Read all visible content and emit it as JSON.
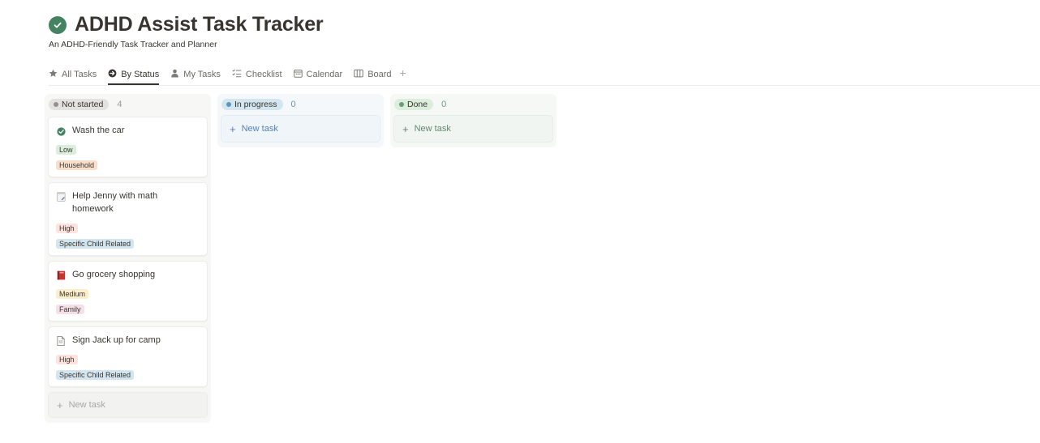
{
  "page": {
    "title": "ADHD Assist Task Tracker",
    "subtitle": "An ADHD-Friendly Task Tracker and Planner",
    "title_icon": "check-circle-icon"
  },
  "tabs": [
    {
      "label": "All Tasks",
      "icon": "star-icon",
      "active": false
    },
    {
      "label": "By Status",
      "icon": "status-arrow-icon",
      "active": true
    },
    {
      "label": "My Tasks",
      "icon": "person-icon",
      "active": false
    },
    {
      "label": "Checklist",
      "icon": "checklist-icon",
      "active": false
    },
    {
      "label": "Calendar",
      "icon": "calendar-icon",
      "active": false
    },
    {
      "label": "Board",
      "icon": "board-icon",
      "active": false
    }
  ],
  "tab_add": "+",
  "columns": [
    {
      "status": "Not started",
      "count": "4",
      "pill_bg": "#e3e2e0",
      "dot": "#91918e",
      "count_color": "#9b9a97",
      "cards": [
        {
          "title": "Wash the car",
          "icon": "check-circle-icon",
          "priority": "Low",
          "priority_bg": "#dbeddb",
          "category": "Household",
          "category_bg": "#fadec9"
        },
        {
          "title": "Help Jenny with math homework",
          "icon": "notepad-icon",
          "priority": "High",
          "priority_bg": "#ffe2dd",
          "category": "Specific Child Related",
          "category_bg": "#d3e5ef"
        },
        {
          "title": "Go grocery shopping",
          "icon": "red-book-icon",
          "priority": "Medium",
          "priority_bg": "#fbeeca",
          "category": "Family",
          "category_bg": "#f5e0e9"
        },
        {
          "title": "Sign Jack up for camp",
          "icon": "document-icon",
          "priority": "High",
          "priority_bg": "#ffe2dd",
          "category": "Specific Child Related",
          "category_bg": "#d3e5ef"
        }
      ],
      "new_task": "New task"
    },
    {
      "status": "In progress",
      "count": "0",
      "pill_bg": "#d3e5ef",
      "dot": "#5b97bd",
      "count_color": "#5b97bd",
      "cards": [],
      "new_task": "New task"
    },
    {
      "status": "Done",
      "count": "0",
      "pill_bg": "#dbeddb",
      "dot": "#6c9b7d",
      "count_color": "#6c9b7d",
      "cards": [],
      "new_task": "New task"
    }
  ]
}
